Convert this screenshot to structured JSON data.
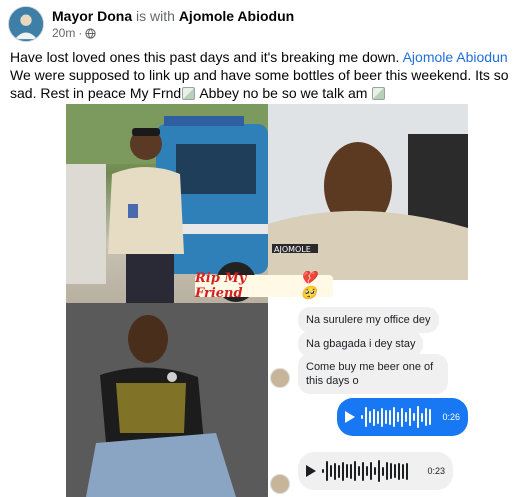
{
  "post": {
    "author": "Mayor Dona",
    "with_text": "is with",
    "tagged": "Ajomole Abiodun",
    "time": "20m",
    "audience_icon": "globe-icon",
    "text_part1": "Have lost loved ones this past days and it's breaking me down.",
    "mention": "Ajomole Abiodun",
    "text_part2": "We were supposed to link up and have some bottles of beer this weekend. Its so sad. Rest in peace My Frnd",
    "text_part3": "Abbey no be so we talk am"
  },
  "collage": {
    "label": "Rip My Friend",
    "label_emoji": "💔🥺",
    "uniform_name_tag": "AJOMOLE"
  },
  "chat": {
    "messages": [
      "Na surulere my office dey",
      "Na gbagada i dey stay",
      "Come buy me beer one of this days o"
    ],
    "voice_out_duration": "0:26",
    "voice_in_duration": "0:23"
  },
  "colors": {
    "link": "#216fdb",
    "brand": "#1877f2",
    "rip": "#d42020"
  }
}
